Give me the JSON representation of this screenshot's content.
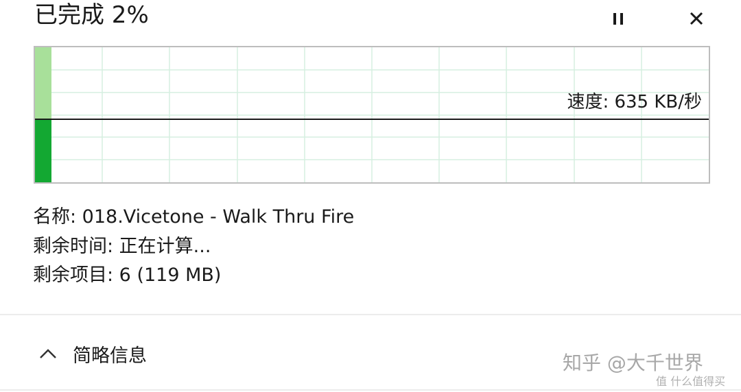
{
  "header": {
    "title": "已完成 2%"
  },
  "progress": {
    "percent": 2
  },
  "graph": {
    "speed_label": "速度: 635 KB/秒"
  },
  "details": {
    "name_line": "名称: 018.Vicetone - Walk Thru Fire",
    "time_line": "剩余时间: 正在计算...",
    "items_line": "剩余项目: 6 (119 MB)"
  },
  "footer": {
    "toggle_label": "简略信息",
    "watermark": "知乎 @大千世界",
    "watermark_small": "值 什么值得买"
  },
  "colors": {
    "progress_fill_dark": "#13a832",
    "progress_fill_light": "#a8e09a",
    "grid_line": "#d6efe0",
    "speed_line": "#1a1a1a"
  },
  "icons": {
    "pause": "pause-icon",
    "close": "close-icon",
    "collapse": "chevron-up-icon"
  }
}
